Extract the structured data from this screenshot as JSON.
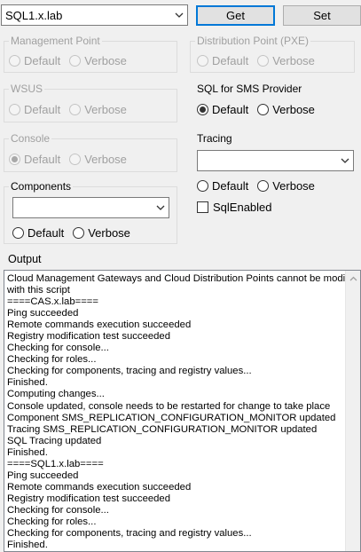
{
  "server": {
    "value": "SQL1.x.lab"
  },
  "buttons": {
    "get": "Get",
    "set": "Set"
  },
  "radio_labels": {
    "default": "Default",
    "verbose": "Verbose"
  },
  "groups": {
    "management_point": {
      "title": "Management Point",
      "enabled": false,
      "selected": "none"
    },
    "distribution_point": {
      "title": "Distribution Point (PXE)",
      "enabled": false,
      "selected": "none"
    },
    "wsus": {
      "title": "WSUS",
      "enabled": false,
      "selected": "none"
    },
    "sql_for_sms_provider": {
      "title": "SQL for SMS Provider",
      "enabled": true,
      "selected": "default"
    },
    "console": {
      "title": "Console",
      "enabled": false,
      "selected": "default"
    },
    "tracing": {
      "title": "Tracing",
      "enabled": true,
      "selected": "none",
      "dropdown_value": "",
      "sql_enabled_label": "SqlEnabled",
      "sql_enabled_checked": false
    },
    "components": {
      "title": "Components",
      "enabled": true,
      "selected": "none",
      "dropdown_value": ""
    }
  },
  "output": {
    "label": "Output",
    "lines": [
      "Cloud Management Gateways and Cloud Distribution Points cannot be modified",
      "with this script",
      "====CAS.x.lab====",
      "Ping succeeded",
      "Remote commands execution succeeded",
      "Registry modification test succeeded",
      "Checking for console...",
      "Checking for roles...",
      "Checking for components, tracing and registry values...",
      "Finished.",
      "Computing changes...",
      "Console updated, console needs to be restarted for change to take place",
      "Component SMS_REPLICATION_CONFIGURATION_MONITOR updated",
      "Tracing SMS_REPLICATION_CONFIGURATION_MONITOR updated",
      "SQL Tracing updated",
      "Finished.",
      "====SQL1.x.lab====",
      "Ping succeeded",
      "Remote commands execution succeeded",
      "Registry modification test succeeded",
      "Checking for console...",
      "Checking for roles...",
      "Checking for components, tracing and registry values...",
      "Finished."
    ]
  },
  "icons": {
    "dropdown": "chevron-down-icon",
    "scroll_up": "scroll-up-arrow-icon"
  }
}
